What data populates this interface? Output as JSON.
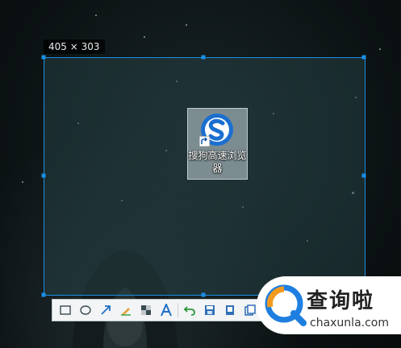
{
  "screenshot_tool": {
    "size_label": "405 × 303",
    "selection_color": "#1b8fe6",
    "toolbar": [
      {
        "name": "rectangle-tool-icon"
      },
      {
        "name": "ellipse-tool-icon"
      },
      {
        "name": "arrow-tool-icon"
      },
      {
        "name": "pencil-tool-icon"
      },
      {
        "name": "mosaic-tool-icon"
      },
      {
        "name": "text-tool-icon"
      },
      {
        "name": "undo-icon"
      },
      {
        "name": "save-icon"
      },
      {
        "name": "pin-icon"
      },
      {
        "name": "copy-icon"
      }
    ]
  },
  "desktop": {
    "shortcut_label": "搜狗高速浏览器"
  },
  "watermark": {
    "title": "查询啦",
    "url": "chaxunla.com",
    "brand_color": "#1f7fe0"
  }
}
